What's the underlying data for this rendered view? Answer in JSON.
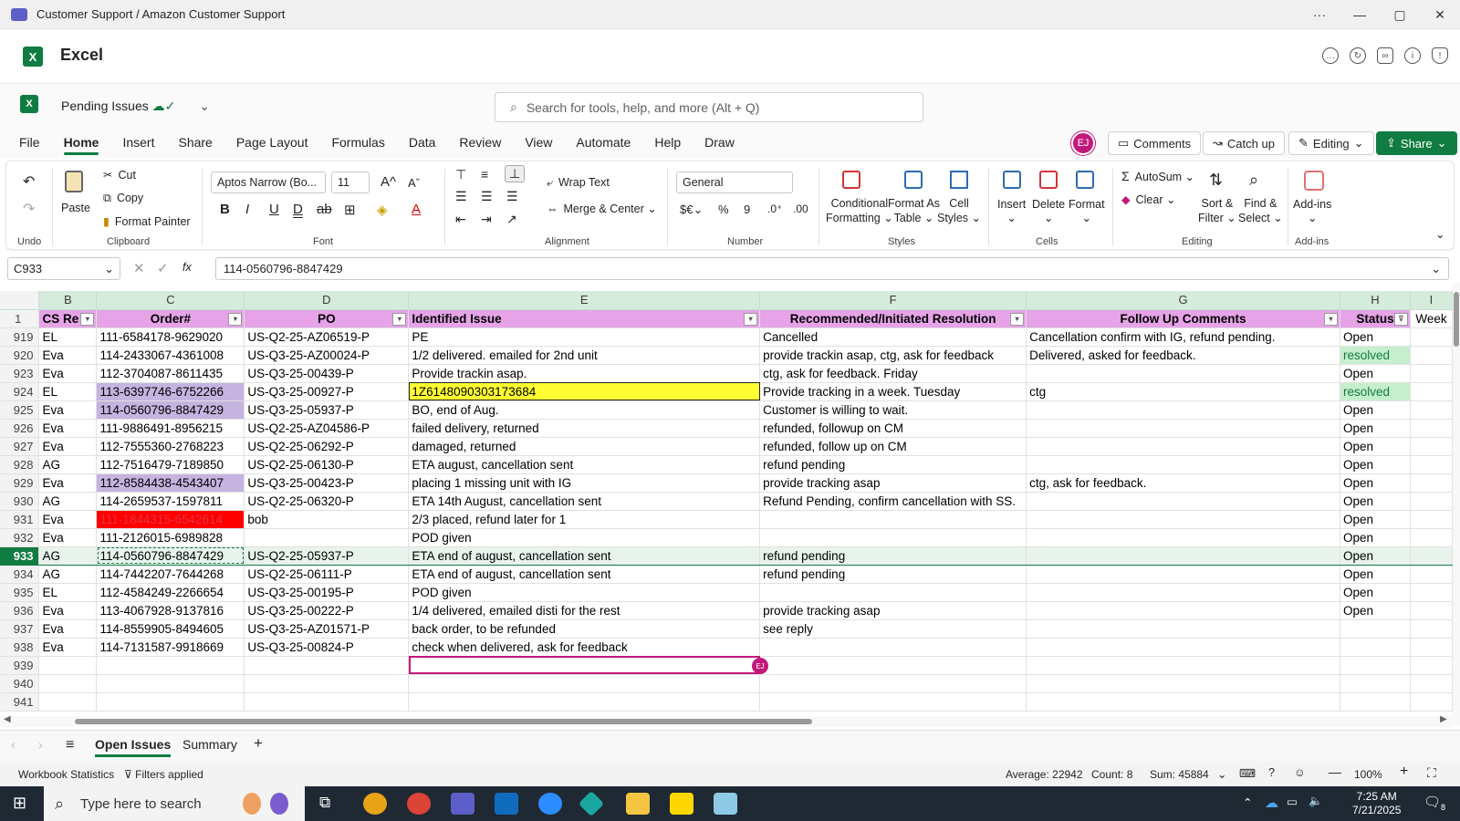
{
  "window": {
    "title": "Customer Support / Amazon Customer Support",
    "more": "···",
    "minimize": "—",
    "maximize": "▢",
    "close": "✕"
  },
  "app": {
    "name": "Excel",
    "logo": "X"
  },
  "doc": {
    "name": "Pending Issues",
    "search_placeholder": "Search for tools, help, and more (Alt + Q)"
  },
  "menu": [
    "File",
    "Home",
    "Insert",
    "Share",
    "Page Layout",
    "Formulas",
    "Data",
    "Review",
    "View",
    "Automate",
    "Help",
    "Draw"
  ],
  "topright": {
    "avatar": "EJ",
    "comments": "Comments",
    "catchup": "Catch up",
    "editing": "Editing",
    "share": "Share"
  },
  "ribbon": {
    "undo_group": "Undo",
    "clipboard": {
      "paste": "Paste",
      "cut": "Cut",
      "copy": "Copy",
      "format_painter": "Format Painter",
      "label": "Clipboard"
    },
    "font": {
      "name": "Aptos Narrow (Bo...",
      "size": "11",
      "label": "Font"
    },
    "alignment": {
      "wrap": "Wrap Text",
      "merge": "Merge & Center",
      "label": "Alignment"
    },
    "number": {
      "format": "General",
      "label": "Number"
    },
    "styles": {
      "cond": "Conditional",
      "cond2": "Formatting",
      "fat": "Format As",
      "fat2": "Table",
      "cell": "Cell",
      "cell2": "Styles",
      "label": "Styles"
    },
    "cells": {
      "insert": "Insert",
      "delete": "Delete",
      "format": "Format",
      "label": "Cells"
    },
    "editing": {
      "autosum": "AutoSum",
      "clear": "Clear",
      "sort": "Sort &",
      "sort2": "Filter",
      "find": "Find &",
      "find2": "Select",
      "label": "Editing"
    },
    "addins": {
      "name": "Add-ins",
      "label": "Add-ins"
    }
  },
  "formula": {
    "namebox": "C933",
    "fx": "fx",
    "value": "114-0560796-8847429"
  },
  "columns": [
    "B",
    "C",
    "D",
    "E",
    "F",
    "G",
    "H",
    "I"
  ],
  "headers": {
    "rownum": "1",
    "b": "CS Re",
    "c": "Order#",
    "d": "PO",
    "e": "Identified Issue",
    "f": "Recommended/Initiated Resolution",
    "g": "Follow Up Comments",
    "h": "Status",
    "i": "Week"
  },
  "rows": [
    {
      "n": "919",
      "b": "EL",
      "c": "111-6584178-9629020",
      "d": "US-Q2-25-AZ06519-P",
      "e": "PE",
      "f": "Cancelled",
      "g": "Cancellation confirm with IG, refund pending.",
      "h": "Open"
    },
    {
      "n": "920",
      "b": "Eva",
      "c": "114-2433067-4361008",
      "d": "US-Q3-25-AZ00024-P",
      "e": "1/2 delivered. emailed for 2nd unit",
      "f": "provide trackin asap, ctg, ask for feedback",
      "g": "Delivered, asked for feedback.",
      "h": "resolved"
    },
    {
      "n": "923",
      "b": "Eva",
      "c": "112-3704087-8611435",
      "d": "US-Q3-25-00439-P",
      "e": "Provide trackin asap.",
      "f": "ctg, ask for feedback. Friday",
      "g": "",
      "h": "Open"
    },
    {
      "n": "924",
      "b": "EL",
      "c": "113-6397746-6752266",
      "d": "US-Q3-25-00927-P",
      "e": "1Z6148090303173684",
      "f": "Provide tracking in a week. Tuesday",
      "g": "ctg",
      "h": "resolved"
    },
    {
      "n": "925",
      "b": "Eva",
      "c": "114-0560796-8847429",
      "d": "US-Q3-25-05937-P",
      "e": "BO, end of Aug.",
      "f": "Customer is willing to wait.",
      "g": "",
      "h": "Open"
    },
    {
      "n": "926",
      "b": "Eva",
      "c": "111-9886491-8956215",
      "d": "US-Q2-25-AZ04586-P",
      "e": "failed delivery, returned",
      "f": "refunded, followup on CM",
      "g": "",
      "h": "Open"
    },
    {
      "n": "927",
      "b": "Eva",
      "c": "112-7555360-2768223",
      "d": "US-Q2-25-06292-P",
      "e": "damaged, returned",
      "f": "refunded, follow up on CM",
      "g": "",
      "h": "Open"
    },
    {
      "n": "928",
      "b": "AG",
      "c": "112-7516479-7189850",
      "d": "US-Q2-25-06130-P",
      "e": "ETA august, cancellation sent",
      "f": "refund pending",
      "g": "",
      "h": "Open"
    },
    {
      "n": "929",
      "b": "Eva",
      "c": "112-8584438-4543407",
      "d": "US-Q3-25-00423-P",
      "e": "placing 1 missing unit with IG",
      "f": "provide tracking asap",
      "g": "ctg, ask for feedback.",
      "h": "Open"
    },
    {
      "n": "930",
      "b": "AG",
      "c": "114-2659537-1597811",
      "d": "US-Q2-25-06320-P",
      "e": "ETA 14th August, cancellation sent",
      "f": "Refund Pending, confirm cancellation with SS.",
      "g": "",
      "h": "Open"
    },
    {
      "n": "931",
      "b": "Eva",
      "c": "111-1844315-6542614",
      "d": "bob",
      "e": "2/3 placed, refund later for 1",
      "f": "",
      "g": "",
      "h": "Open"
    },
    {
      "n": "932",
      "b": "Eva",
      "c": "111-2126015-6989828",
      "d": "",
      "e": "POD given",
      "f": "",
      "g": "",
      "h": "Open"
    },
    {
      "n": "933",
      "b": "AG",
      "c": "114-0560796-8847429",
      "d": "US-Q2-25-05937-P",
      "e": "ETA end of august, cancellation sent",
      "f": "refund pending",
      "g": "",
      "h": "Open"
    },
    {
      "n": "934",
      "b": "AG",
      "c": "114-7442207-7644268",
      "d": "US-Q2-25-06111-P",
      "e": "ETA end of august, cancellation sent",
      "f": "refund pending",
      "g": "",
      "h": "Open"
    },
    {
      "n": "935",
      "b": "EL",
      "c": "112-4584249-2266654",
      "d": "US-Q3-25-00195-P",
      "e": "POD given",
      "f": "",
      "g": "",
      "h": "Open"
    },
    {
      "n": "936",
      "b": "Eva",
      "c": "113-4067928-9137816",
      "d": "US-Q3-25-00222-P",
      "e": "1/4 delivered, emailed disti for the rest",
      "f": "provide tracking asap",
      "g": "",
      "h": "Open"
    },
    {
      "n": "937",
      "b": "Eva",
      "c": "114-8559905-8494605",
      "d": "US-Q3-25-AZ01571-P",
      "e": "back order, to be refunded",
      "f": "see reply",
      "g": "",
      "h": ""
    },
    {
      "n": "938",
      "b": "Eva",
      "c": "114-7131587-9918669",
      "d": "US-Q3-25-00824-P",
      "e": "check when delivered, ask for feedback",
      "f": "",
      "g": "",
      "h": ""
    },
    {
      "n": "939",
      "b": "",
      "c": "",
      "d": "",
      "e": "",
      "f": "",
      "g": "",
      "h": ""
    },
    {
      "n": "940",
      "b": "",
      "c": "",
      "d": "",
      "e": "",
      "f": "",
      "g": "",
      "h": ""
    },
    {
      "n": "941",
      "b": "",
      "c": "",
      "d": "",
      "e": "",
      "f": "",
      "g": "",
      "h": ""
    }
  ],
  "highlight_colors": {
    "purple": "#c5b3e0",
    "red": "#ff0000",
    "yellow": "#ffff33",
    "green": "#c6efce",
    "brand": "#107c41"
  },
  "sheets": {
    "active": "Open Issues",
    "other": "Summary",
    "add": "+"
  },
  "statusbar": {
    "stats": "Workbook Statistics",
    "filters": "Filters applied",
    "average": "Average: 22942",
    "count": "Count: 8",
    "sum": "Sum: 45884",
    "zoom": "100%"
  },
  "taskbar": {
    "search": "Type here to search",
    "time": "7:25 AM",
    "date": "7/21/2025",
    "notif": "8"
  }
}
